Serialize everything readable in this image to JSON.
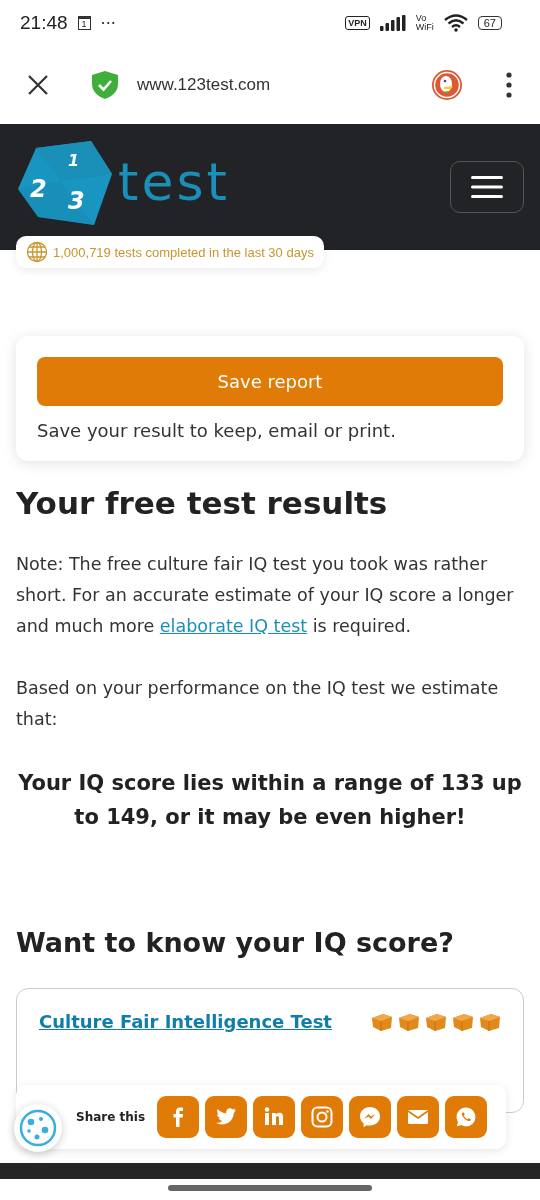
{
  "status_bar": {
    "time": "21:48",
    "calendar_day": "1",
    "more": "···",
    "vpn": "VPN",
    "vowifi_top": "Vo",
    "vowifi_bottom": "WiFi",
    "battery": "67"
  },
  "browser": {
    "url": "www.123test.com"
  },
  "site_header": {
    "logo_text": "test",
    "logo_digits": [
      "1",
      "2",
      "3"
    ],
    "tests_badge": "1,000,719 tests completed in the last 30 days"
  },
  "save_card": {
    "button": "Save report",
    "note": "Save your result to keep, email or print."
  },
  "results": {
    "heading": "Your free test results",
    "paragraphs": [
      {
        "text": "Note: The free culture fair IQ test you took was rather short. For an accurate estimate of your IQ score a longer and much more ",
        "link": "elaborate IQ test",
        "after": " is required."
      },
      {
        "text": "Based on your performance on the IQ test we estimate that:"
      }
    ],
    "score": "Your IQ score lies within a range of 133 up to 149, or it may be even higher!"
  },
  "offer": {
    "heading": "Want to know your IQ score?",
    "test_link": "Culture Fair Intelligence Test",
    "stars": 5
  },
  "share_bar": {
    "label": "Share this",
    "buttons": [
      {
        "kind": "facebook"
      },
      {
        "kind": "twitter"
      },
      {
        "kind": "linkedin"
      },
      {
        "kind": "instagram"
      },
      {
        "kind": "messenger"
      },
      {
        "kind": "email"
      },
      {
        "kind": "whatsapp"
      }
    ]
  }
}
